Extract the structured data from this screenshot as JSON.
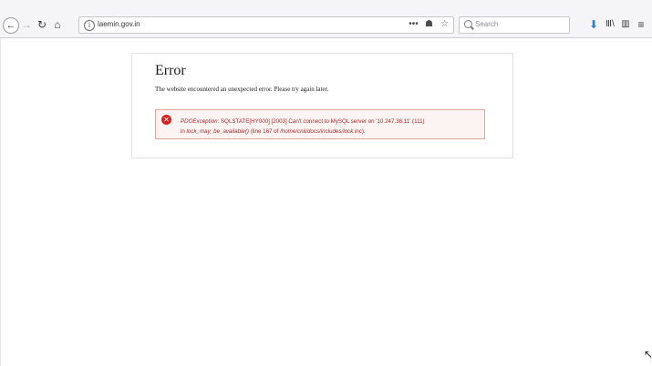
{
  "browser": {
    "nav": {
      "back_icon": "arrow-left-icon",
      "forward_icon": "arrow-right-icon",
      "reload_icon": "reload-icon",
      "home_icon": "home-icon"
    },
    "urlbar": {
      "url": "laemin.gov.in",
      "actions": [
        "•••",
        "☗",
        "☆"
      ]
    },
    "search": {
      "placeholder": "Search"
    },
    "toolbar_icons": [
      "download-icon",
      "library-icon",
      "sidebar-icon",
      "menu-icon"
    ]
  },
  "page": {
    "title": "Error",
    "description": "The website encountered an unexpected error. Please try again later.",
    "message": {
      "exception_class": "PDOException",
      "text_part1": ": SQLSTATE[HY000] [2003] Can't connect to MySQL server on '10.247.38.11' (111)",
      "text_in": "in ",
      "function": "lock_may_be_available()",
      "location": " (line 167 of ",
      "file": "/home/cnil/docs/includes/lock.inc",
      "location_end": ")."
    }
  },
  "colors": {
    "error_icon": "#d72222",
    "error_text": "#a52a2a",
    "error_border": "#e0a699",
    "error_bg": "#fcf4f2",
    "download_blue": "#2a7fdb"
  }
}
